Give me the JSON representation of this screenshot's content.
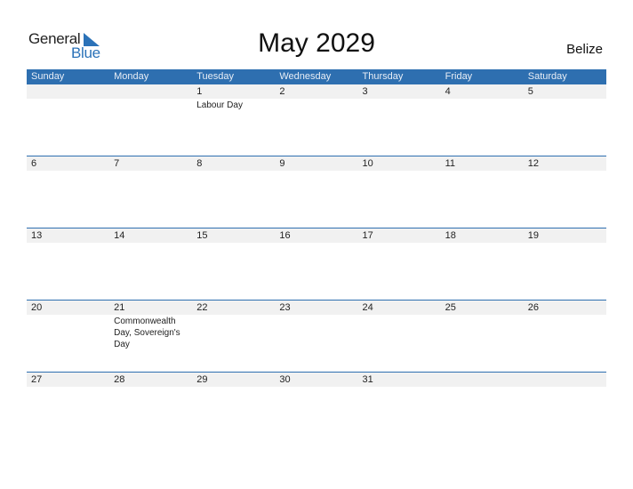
{
  "brand": {
    "word1": "General",
    "word2": "Blue",
    "accent": "#2b72b8"
  },
  "title": "May 2029",
  "country": "Belize",
  "colors": {
    "header_bg": "#2e6fb0",
    "band_bg": "#f1f1f1"
  },
  "weekdays": [
    "Sunday",
    "Monday",
    "Tuesday",
    "Wednesday",
    "Thursday",
    "Friday",
    "Saturday"
  ],
  "weeks": [
    {
      "days": [
        "",
        "",
        "1",
        "2",
        "3",
        "4",
        "5"
      ],
      "events": [
        "",
        "",
        "Labour Day",
        "",
        "",
        "",
        ""
      ]
    },
    {
      "days": [
        "6",
        "7",
        "8",
        "9",
        "10",
        "11",
        "12"
      ],
      "events": [
        "",
        "",
        "",
        "",
        "",
        "",
        ""
      ]
    },
    {
      "days": [
        "13",
        "14",
        "15",
        "16",
        "17",
        "18",
        "19"
      ],
      "events": [
        "",
        "",
        "",
        "",
        "",
        "",
        ""
      ]
    },
    {
      "days": [
        "20",
        "21",
        "22",
        "23",
        "24",
        "25",
        "26"
      ],
      "events": [
        "",
        "Commonwealth Day, Sovereign's Day",
        "",
        "",
        "",
        "",
        ""
      ]
    },
    {
      "days": [
        "27",
        "28",
        "29",
        "30",
        "31",
        "",
        ""
      ],
      "events": [
        "",
        "",
        "",
        "",
        "",
        "",
        ""
      ]
    }
  ]
}
